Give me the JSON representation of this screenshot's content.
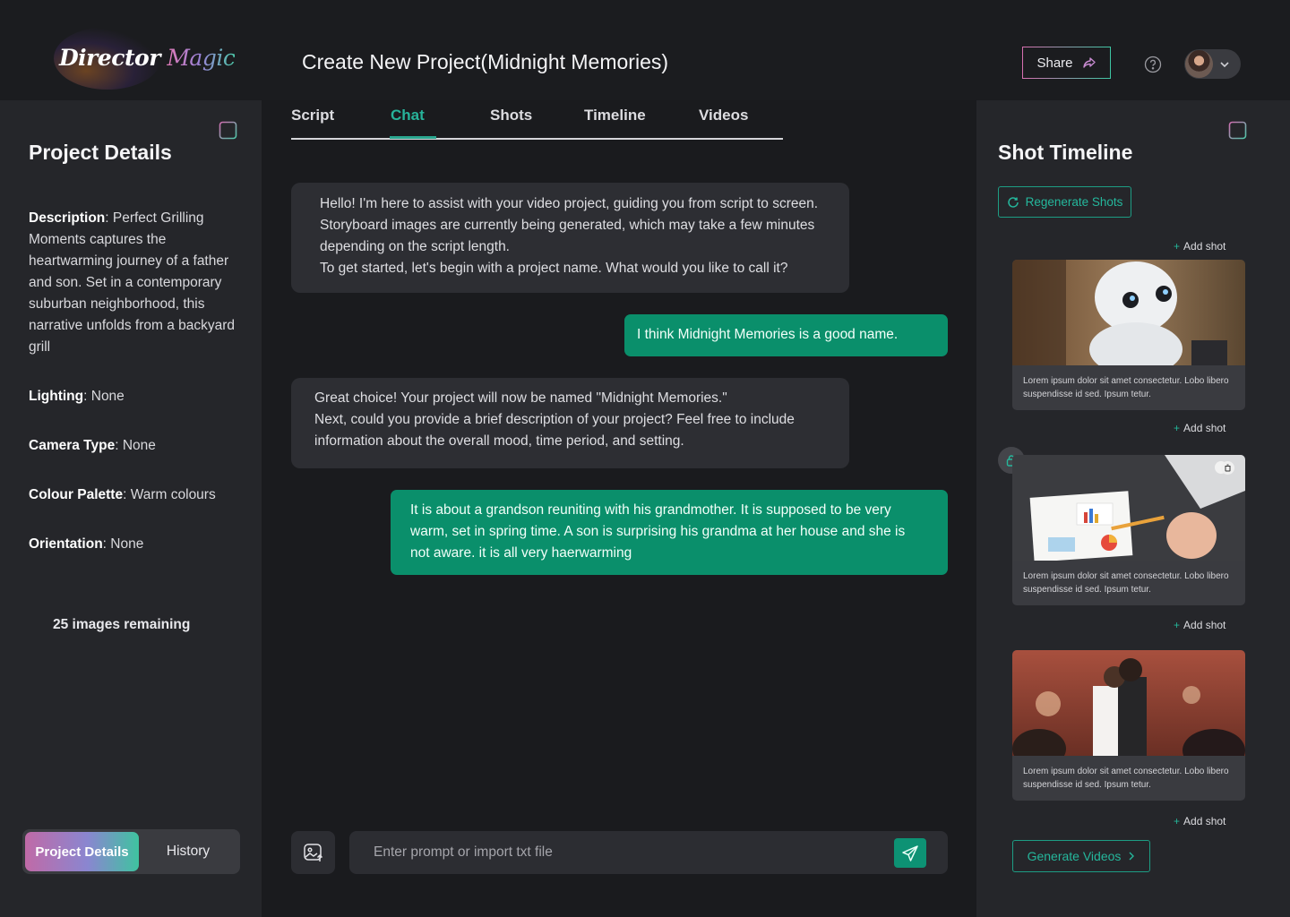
{
  "header": {
    "logo_word1": "Director",
    "logo_word2": "Magic",
    "title": "Create New Project(Midnight Memories)",
    "share_label": "Share"
  },
  "left_panel": {
    "title": "Project Details",
    "description_label": "Description",
    "description_value": " Perfect Grilling Moments captures the heartwarming journey of a father and son. Set in a contemporary suburban neighborhood, this narrative unfolds from a backyard grill",
    "lighting_label": "Lighting",
    "lighting_value": " None",
    "camera_label": "Camera Type",
    "camera_value": " None",
    "palette_label": "Colour Palette",
    "palette_value": " Warm colours",
    "orientation_label": "Orientation",
    "orientation_value": " None",
    "images_remaining": "25 images remaining",
    "tab_active": "Project Details",
    "tab_inactive": "History"
  },
  "tabs": [
    {
      "label": "Script"
    },
    {
      "label": "Chat"
    },
    {
      "label": "Shots"
    },
    {
      "label": "Timeline"
    },
    {
      "label": "Videos"
    }
  ],
  "chat": {
    "messages": [
      {
        "role": "bot",
        "lines": [
          "Hello! I'm here to assist with your video project, guiding you from script to screen. Storyboard images are currently being generated, which may take a few minutes depending on the script length.",
          "To get started, let's begin with a project name. What would you like to call it?"
        ]
      },
      {
        "role": "user",
        "lines": [
          "I think Midnight Memories is a good name."
        ]
      },
      {
        "role": "bot",
        "lines": [
          "Great choice! Your project will now be named \"Midnight Memories.\"",
          "Next, could you provide a brief description of your project? Feel free to include information about the overall mood, time period, and setting."
        ]
      },
      {
        "role": "user",
        "lines": [
          "It is about a grandson reuniting with his grandmother. It is supposed to be very warm, set in spring time. A son is surprising his grandma at her house and she is not aware. it is all very haerwarming"
        ]
      }
    ],
    "input_placeholder": "Enter prompt or import txt file"
  },
  "right_panel": {
    "title": "Shot Timeline",
    "regenerate_label": "Regenerate Shots",
    "add_shot_label": "Add shot",
    "shots": [
      {
        "caption": "Lorem ipsum dolor sit amet consectetur. Lobo libero suspendisse id sed. Ipsum  tetur."
      },
      {
        "caption": "Lorem ipsum dolor sit amet consectetur. Lobo libero suspendisse id sed. Ipsum  tetur."
      },
      {
        "caption": "Lorem ipsum dolor sit amet consectetur. Lobo libero suspendisse id sed. Ipsum  tetur."
      }
    ],
    "generate_label": "Generate Videos"
  },
  "colors": {
    "accent": "#0a8f6b",
    "accent_text": "#27b39a",
    "panel_bg": "#25262a",
    "page_bg": "#1a1b1e"
  }
}
